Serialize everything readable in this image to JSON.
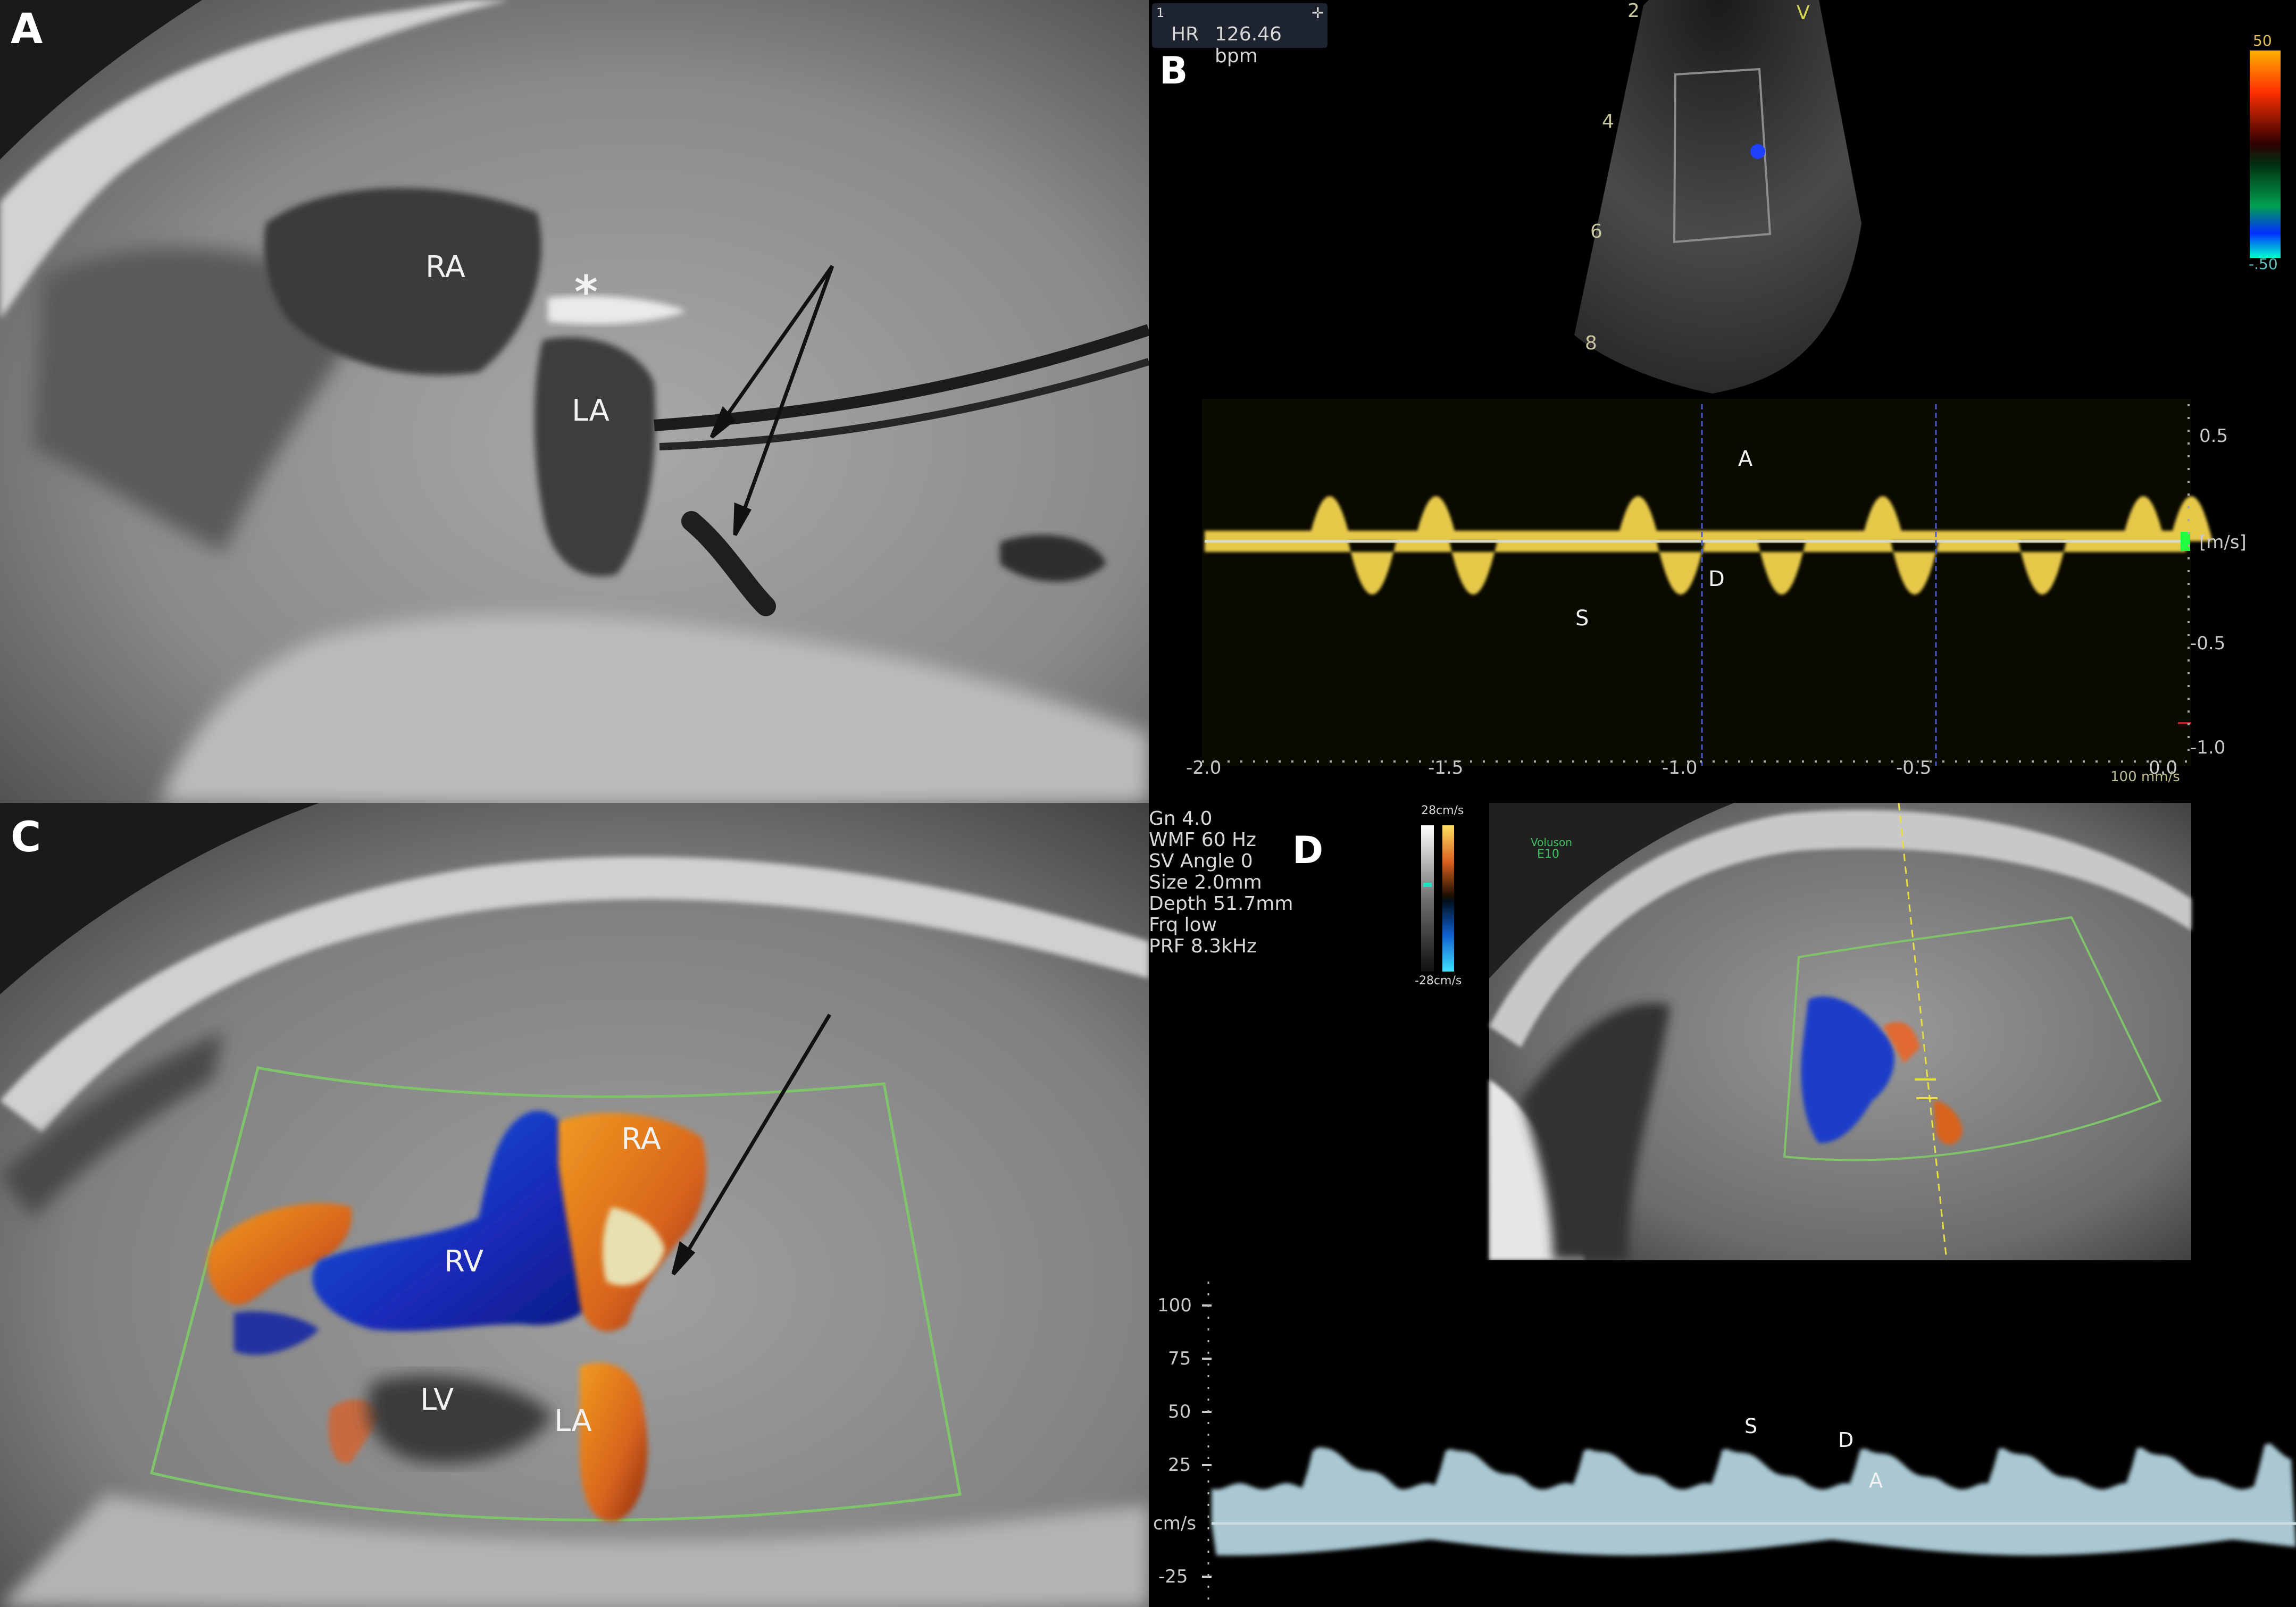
{
  "panels": {
    "a": {
      "letter": "A",
      "labels": {
        "ra": "RA",
        "la": "LA",
        "asterisk": "*"
      }
    },
    "b": {
      "letter": "B",
      "hr_label": "HR",
      "hr_value": "126.46 bpm",
      "hr_index": "1",
      "mode_marker": "V",
      "depth_marks": [
        "2",
        "4",
        "6",
        "8"
      ],
      "color_scale": {
        "max": "50",
        "min": "-.50"
      },
      "velocity_unit": "[m/s]",
      "y_ticks": [
        "0.5",
        "-0.5",
        "-1.0"
      ],
      "x_ticks": [
        "-2.0",
        "-1.5",
        "-1.0",
        "-0.5",
        "0.0"
      ],
      "sweep": "100 mm/s",
      "waves": {
        "s": "S",
        "d": "D",
        "a": "A"
      }
    },
    "c": {
      "letter": "C",
      "labels": {
        "ra": "RA",
        "rv": "RV",
        "lv": "LV",
        "la": "LA"
      }
    },
    "d": {
      "letter": "D",
      "settings": [
        "Gn  4.0",
        "WMF 60 Hz",
        "SV Angle  0",
        "Size  2.0mm",
        "Depth 51.7mm",
        "Frq low",
        "PRF  8.3kHz"
      ],
      "color_scale": {
        "max": "28cm/s",
        "min": "-28cm/s"
      },
      "device": [
        "Voluson",
        "E10"
      ],
      "y_ticks": [
        "100",
        "75",
        "50",
        "25",
        "-25"
      ],
      "unit": "cm/s",
      "waves": {
        "s": "S",
        "d": "D",
        "a": "A"
      }
    }
  },
  "colors": {
    "doppler_trace": "#e6c84a",
    "baseline": "#d8d8c8",
    "sector_outline": "#7fc36b",
    "flow_red": "#d8641e",
    "flow_blue": "#1e46c8",
    "pw_trace_d": "#a9c8d2"
  }
}
